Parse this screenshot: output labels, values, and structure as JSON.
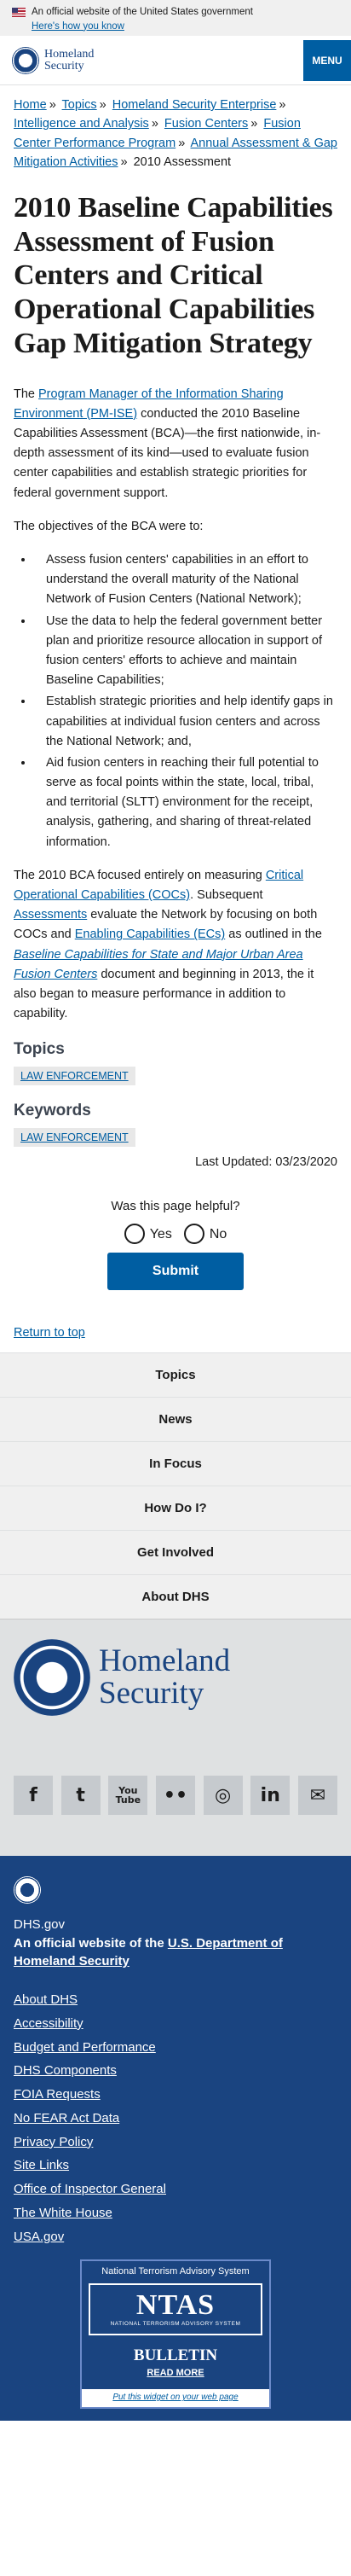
{
  "banner": {
    "text": "An official website of the United States government",
    "how": "Here's how you know"
  },
  "header": {
    "logo_line1": "Homeland",
    "logo_line2": "Security",
    "menu": "MENU"
  },
  "breadcrumb": {
    "items": [
      "Home",
      "Topics",
      "Homeland Security Enterprise",
      "Intelligence and Analysis",
      "Fusion Centers",
      "Fusion Center Performance Program",
      "Annual Assessment & Gap Mitigation Activities"
    ],
    "current": "2010 Assessment"
  },
  "title": "2010 Baseline Capabilities Assessment of Fusion Centers and Critical Operational Capabilities Gap Mitigation Strategy",
  "content": {
    "p1_link": "Program Manager of the Information Sharing Environment (PM-ISE)",
    "p1_rest": " conducted the 2010 Baseline Capabilities Assessment (BCA)—the first nationwide, in-depth assessment of its kind—used to evaluate fusion center capabilities and establish strategic priorities for federal government support.",
    "p1_pre": "The ",
    "p2": "The objectives of the BCA were to:",
    "bullets": [
      "Assess fusion centers' capabilities in an effort to understand the overall maturity of the National Network of Fusion Centers (National Network);",
      "Use the data to help the federal government better plan and prioritize resource allocation in support of fusion centers' efforts to achieve and maintain Baseline Capabilities;",
      "Establish strategic priorities and help identify gaps in capabilities at individual fusion centers and across the National Network; and,",
      "Aid fusion centers in reaching their full potential to serve as focal points within the state, local, tribal, and territorial (SLTT) environment for the receipt, analysis, gathering, and sharing of threat-related information."
    ],
    "p3_a": "The 2010 BCA focused entirely on measuring ",
    "p3_link1": "Critical Operational Capabilities (COCs)",
    "p3_b": ". Subsequent ",
    "p3_link2": "Assessments",
    "p3_c": " evaluate the Network  by focusing on both COCs and ",
    "p3_link3": "Enabling Capabilities (ECs)",
    "p3_d": " as outlined in the ",
    "p3_link4": "Baseline Capabilities for State and Major Urban Area Fusion Centers",
    "p3_e": " document and  beginning in 2013, the it also began to measure performance in addition to capability."
  },
  "topics": {
    "heading": "Topics",
    "tag": "LAW ENFORCEMENT"
  },
  "keywords": {
    "heading": "Keywords",
    "tag": "LAW ENFORCEMENT"
  },
  "updated": "Last Updated: 03/23/2020",
  "feedback": {
    "question": "Was this page helpful?",
    "yes": "Yes",
    "no": "No",
    "submit": "Submit"
  },
  "return_top": "Return to top",
  "footer_nav": [
    "Topics",
    "News",
    "In Focus",
    "How Do I?",
    "Get Involved",
    "About DHS"
  ],
  "brand": {
    "line1": "Homeland",
    "line2": "Security"
  },
  "social": [
    "f",
    "t",
    "You Tube",
    "••",
    "◎",
    "in",
    "✉"
  ],
  "footer": {
    "site": "DHS.gov",
    "official_pre": "An official website of the ",
    "official_link": "U.S. Department of Homeland Security",
    "links": [
      "About DHS",
      "Accessibility",
      "Budget and Performance",
      "DHS Components",
      "FOIA Requests",
      "No FEAR Act Data",
      "Privacy Policy",
      "Site Links",
      "Office of Inspector General",
      "The White House",
      "USA.gov"
    ]
  },
  "ntas": {
    "title": "National Terrorism Advisory System",
    "big": "NTAS",
    "sub": "NATIONAL TERRORISM ADVISORY SYSTEM",
    "bulletin": "BULLETIN",
    "read_more": "READ MORE",
    "put": "Put this widget on your web page"
  }
}
